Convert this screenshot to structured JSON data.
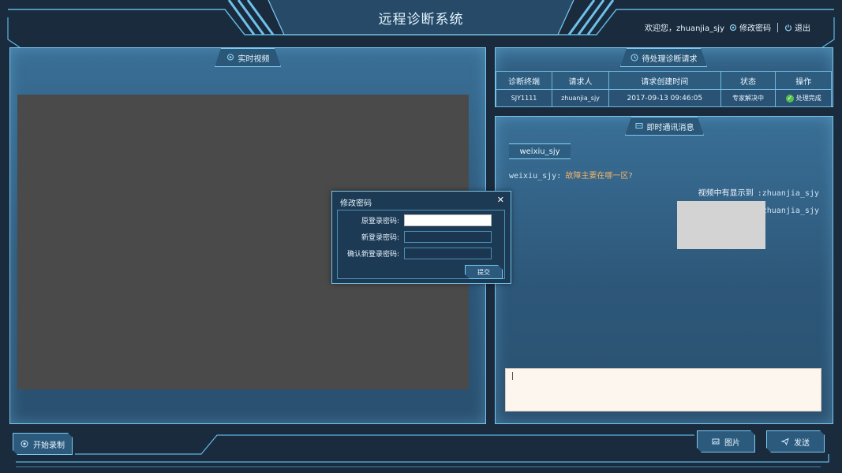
{
  "header": {
    "title": "远程诊断系统",
    "welcome": "欢迎您，zhuanjia_sjy",
    "change_password": "修改密码",
    "logout": "退出"
  },
  "video_panel": {
    "title": "实时视频",
    "record_button": "开始录制"
  },
  "requests_panel": {
    "title": "待处理诊断请求",
    "columns": [
      "诊断终端",
      "请求人",
      "请求创建时间",
      "状态",
      "操作"
    ],
    "rows": [
      {
        "terminal": "SJY1111",
        "requester": "zhuanjia_sjy",
        "created": "2017-09-13 09:46:05",
        "status": "专家解决中",
        "action": "处理完成"
      }
    ]
  },
  "chat_panel": {
    "title": "即时通讯消息",
    "active_user": "weixiu_sjy",
    "messages": [
      {
        "side": "left",
        "sender": "weixiu_sjy:",
        "text": "故障主要在哪一区?"
      },
      {
        "side": "right",
        "sender": ":zhuanjia_sjy",
        "text": "视频中有显示到"
      },
      {
        "side": "right",
        "sender": ":zhuanjia_sjy",
        "text": "",
        "image": true
      }
    ],
    "input_value": "",
    "image_button": "图片",
    "send_button": "发送"
  },
  "modal": {
    "title": "修改密码",
    "old_label": "原登录密码:",
    "new_label": "新登录密码:",
    "confirm_label": "确认新登录密码:",
    "submit": "提交"
  },
  "colors": {
    "background": "#1a2b3d",
    "panel": "#2d5779",
    "accent": "#79c7ef",
    "chat_highlight": "#f2b36a",
    "done": "#56c24d"
  }
}
